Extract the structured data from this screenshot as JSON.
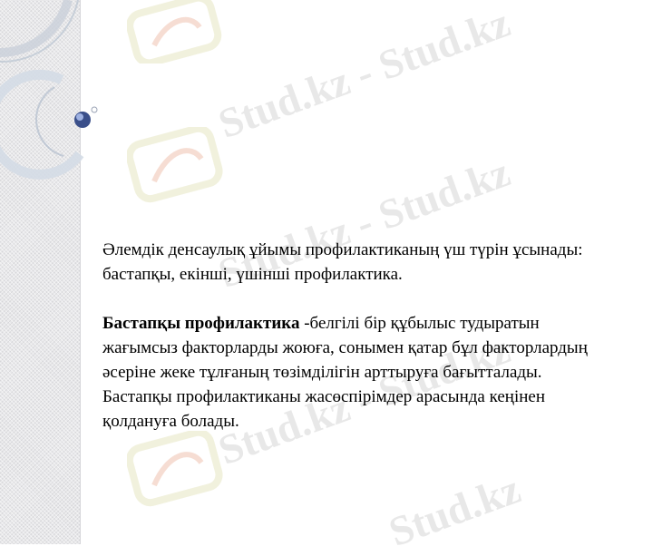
{
  "watermark": {
    "text": "Stud.kz - Stud.kz",
    "text_short": "Stud.kz"
  },
  "content": {
    "para1_line1": "Әлемдік денсаулық ұйымы профилактиканың үш түрін ұсынады:",
    "para1_line2": "бастапқы, екінші, үшінші профилактика.",
    "para2_bold": "Бастапқы профилактика",
    "para2_line1_rest": " -белгілі бір құбылыс тудыратын",
    "para2_line2": "жағымсыз факторларды жоюға, сонымен қатар бұл факторлардың",
    "para2_line3": "әсеріне жеке тұлғаның төзімділігін арттыруға бағытталады.",
    "para2_line4": "Бастапқы профилактиканы жасөспірімдер арасында кеңінен",
    "para2_line5": "қолдануға болады."
  },
  "colors": {
    "strip": "#e8e8ea",
    "ring": "#c9d3df",
    "dot": "#3a4f8a",
    "text": "#000000"
  }
}
